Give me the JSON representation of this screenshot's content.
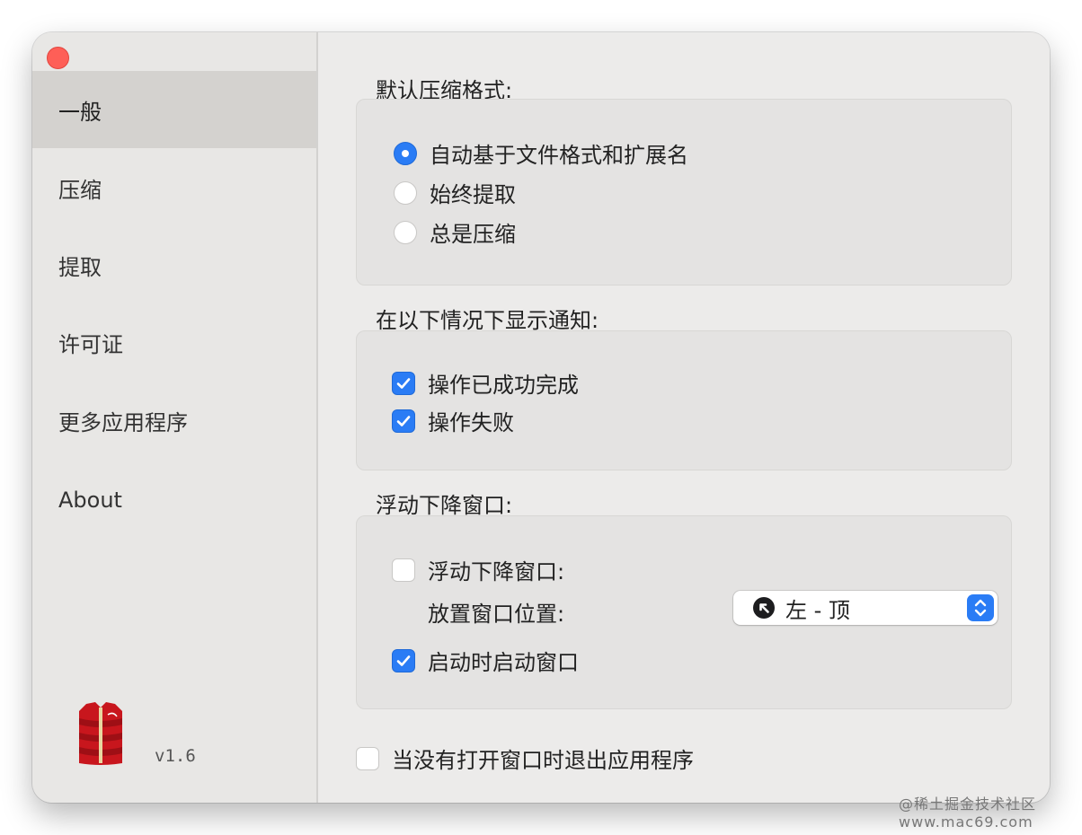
{
  "sidebar": {
    "items": [
      {
        "label": "一般",
        "active": true
      },
      {
        "label": "压缩",
        "active": false
      },
      {
        "label": "提取",
        "active": false
      },
      {
        "label": "许可证",
        "active": false
      },
      {
        "label": "更多应用程序",
        "active": false
      },
      {
        "label": "About",
        "active": false
      }
    ],
    "app_icon": "red-puffer-jacket-app-icon",
    "version": "v1.6"
  },
  "main": {
    "compress_format": {
      "title": "默认压缩格式:",
      "options": [
        {
          "label": "自动基于文件格式和扩展名",
          "selected": true
        },
        {
          "label": "始终提取",
          "selected": false
        },
        {
          "label": "总是压缩",
          "selected": false
        }
      ]
    },
    "notifications": {
      "title": "在以下情况下显示通知:",
      "options": [
        {
          "label": "操作已成功完成",
          "checked": true
        },
        {
          "label": "操作失败",
          "checked": true
        }
      ]
    },
    "floating_window": {
      "title": "浮动下降窗口:",
      "enable": {
        "label": "浮动下降窗口:",
        "checked": false
      },
      "position_label": "放置窗口位置:",
      "position_value": "左 - 顶",
      "position_icon": "arrow-up-left-circle-icon",
      "launch": {
        "label": "启动时启动窗口",
        "checked": true
      }
    },
    "quit_option": {
      "label": "当没有打开窗口时退出应用程序",
      "checked": false
    }
  },
  "watermark": "@稀土掘金技术社区 www.mac69.com",
  "colors": {
    "accent": "#2a7cf5",
    "close": "#fe5f57",
    "sidebar_active": "#d4d2cf"
  }
}
